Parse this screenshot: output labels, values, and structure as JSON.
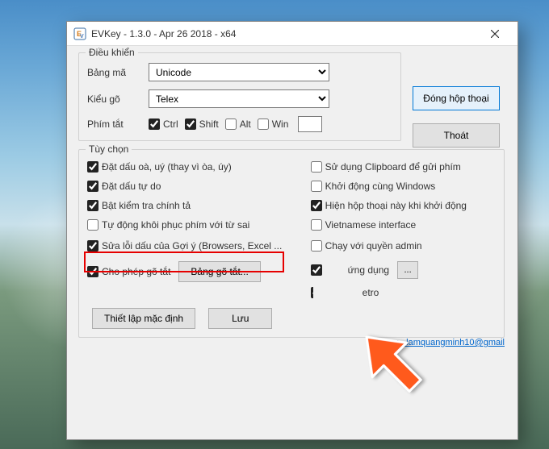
{
  "titlebar": {
    "title": "EVKey - 1.3.0 - Apr 26 2018 - x64"
  },
  "group1": {
    "title": "Điều khiển",
    "encoding_label": "Bảng mã",
    "encoding_value": "Unicode",
    "input_label": "Kiểu gõ",
    "input_value": "Telex",
    "hotkey_label": "Phím tắt",
    "ctrl": "Ctrl",
    "shift": "Shift",
    "alt": "Alt",
    "win": "Win"
  },
  "buttons": {
    "close_dialog": "Đóng hộp thoại",
    "exit": "Thoát",
    "shortcut_table": "Bảng gõ tắt...",
    "default": "Thiết lập mặc định",
    "save": "Lưu",
    "ellipsis": "..."
  },
  "group2": {
    "title": "Tùy chọn",
    "left": {
      "o1": "Đặt dấu oà, uý (thay vì òa, úy)",
      "o2": "Đặt dấu tự do",
      "o3": "Bật kiểm tra chính tả",
      "o4": "Tự động khôi phục phím với từ sai",
      "o5": "Sửa lỗi dấu của Gợi ý (Browsers, Excel ...",
      "o6": "Cho phép gõ tắt"
    },
    "right": {
      "r1": "Sử dụng Clipboard để gửi phím",
      "r2": "Khởi động cùng Windows",
      "r3": "Hiện hộp thoại này khi khởi động",
      "r4": "Vietnamese interface",
      "r5": "Chạy với quyền admin",
      "r6_partial": "ứng dụng",
      "r7_partial": "etro"
    }
  },
  "footer": {
    "link": "EVKey - lamquangminh10@gmail"
  }
}
